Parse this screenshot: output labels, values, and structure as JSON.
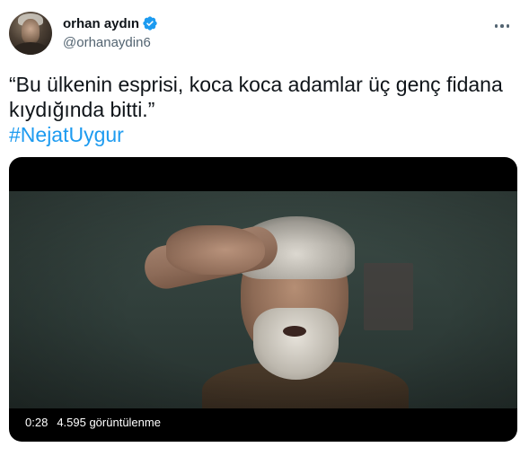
{
  "author": {
    "display_name": "orhan aydın",
    "handle": "@orhanaydin6",
    "verified": true,
    "verified_color": "#1d9bf0"
  },
  "tweet": {
    "text": "“Bu ülkenin esprisi, koca koca adamlar üç genç fidana kıydığında bitti.”",
    "hashtag": "#NejatUygur",
    "hashtag_color": "#1d9bf0"
  },
  "video": {
    "elapsed": "0:28",
    "views": "4.595 görüntülenme"
  },
  "icons": {
    "more": "more-horizontal-icon",
    "verified": "verified-badge-icon"
  }
}
